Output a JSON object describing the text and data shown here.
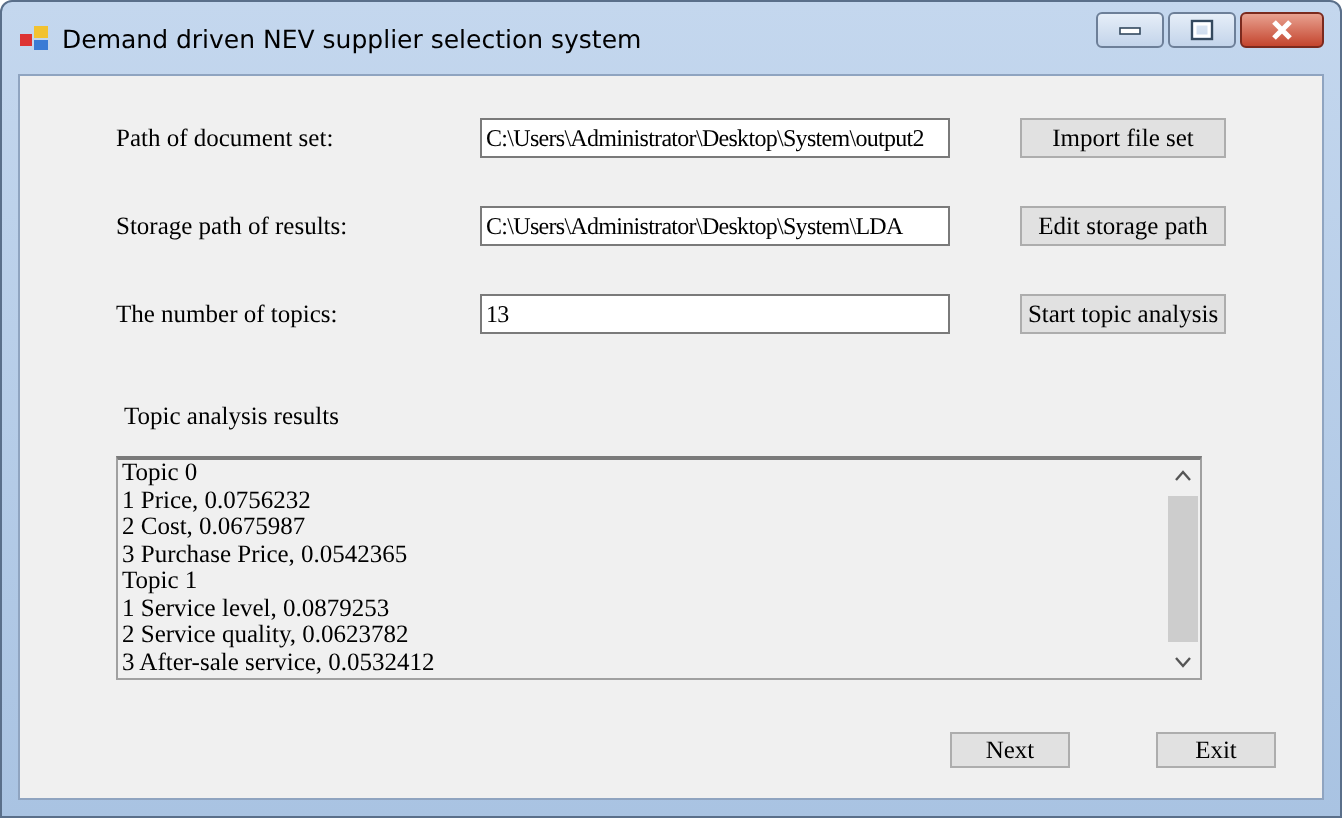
{
  "window": {
    "title": "Demand driven NEV supplier selection system"
  },
  "fields": [
    {
      "label": "Path of document set:",
      "value": "C:\\Users\\Administrator\\Desktop\\System\\output2",
      "button": "Import file set"
    },
    {
      "label": "Storage path of results:",
      "value": "C:\\Users\\Administrator\\Desktop\\System\\LDA",
      "button": "Edit storage path"
    },
    {
      "label": "The number of topics:",
      "value": "13",
      "button": "Start topic analysis"
    }
  ],
  "results": {
    "label": "Topic analysis results",
    "lines": [
      "Topic 0",
      "1 Price, 0.0756232",
      "2 Cost, 0.0675987",
      "3 Purchase Price, 0.0542365",
      "Topic 1",
      "1 Service level, 0.0879253",
      "2 Service quality, 0.0623782",
      "3 After-sale service, 0.0532412"
    ]
  },
  "buttons": [
    "Next",
    "Exit"
  ]
}
